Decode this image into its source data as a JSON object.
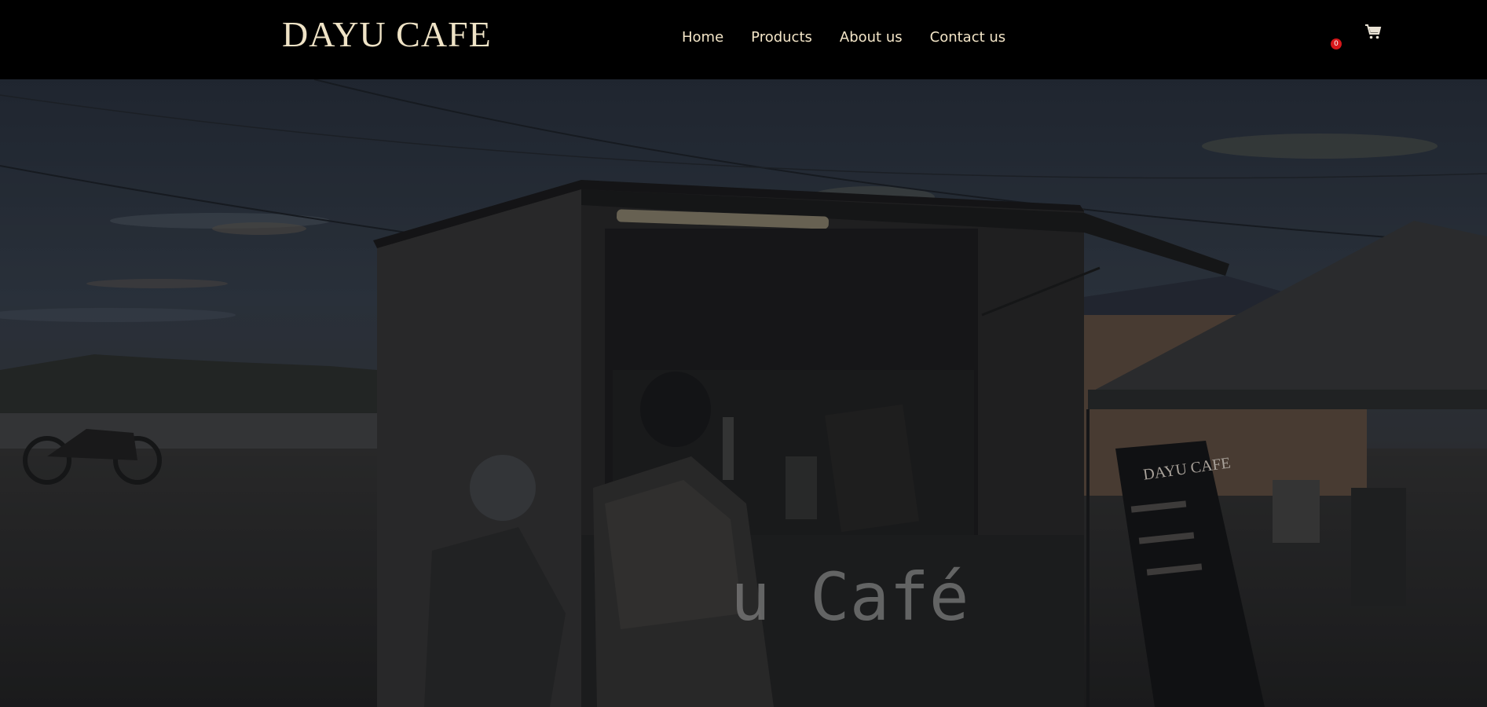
{
  "header": {
    "logo": "DAYU CAFE",
    "nav": [
      {
        "label": "Home"
      },
      {
        "label": "Products"
      },
      {
        "label": "About us"
      },
      {
        "label": "Contact us"
      }
    ],
    "cart": {
      "icon": "shopping-cart-icon",
      "count": "0"
    }
  },
  "hero": {
    "truck_sign": "u Café",
    "board_sign": "DAYU CAFE"
  },
  "colors": {
    "header_bg": "#000000",
    "logo": "#efe3c6",
    "nav_text": "#f4e6c8",
    "badge": "#d7171a"
  }
}
